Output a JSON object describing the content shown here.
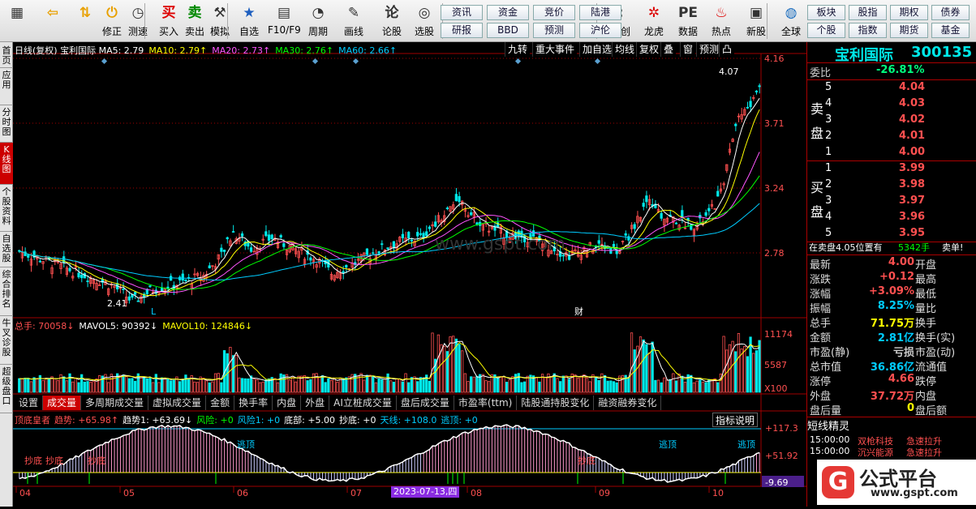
{
  "toolbar": {
    "buttons": [
      {
        "label": "",
        "icon": "windows-icon",
        "name": "windows-button"
      },
      {
        "label": "",
        "icon": "back-arrow-icon",
        "name": "back-button"
      },
      {
        "label": "",
        "icon": "up-down-arrow-icon",
        "name": "scroll-button"
      },
      {
        "label": "修正",
        "icon": "fix-icon",
        "name": "fix-button"
      },
      {
        "label": "测速",
        "icon": "speed-icon",
        "name": "speed-button"
      },
      {
        "label": "买入",
        "icon": "buy-icon",
        "name": "buy-button"
      },
      {
        "label": "卖出",
        "icon": "sell-icon",
        "name": "sell-button"
      },
      {
        "label": "模拟",
        "icon": "simulate-icon",
        "name": "simulate-button"
      },
      {
        "label": "自选",
        "icon": "star-icon",
        "name": "watchlist-button"
      },
      {
        "label": "F10/F9",
        "icon": "f10-icon",
        "name": "f10-button"
      },
      {
        "label": "周期",
        "icon": "period-icon",
        "name": "period-button"
      },
      {
        "label": "画线",
        "icon": "pencil-icon",
        "name": "draw-line-button"
      },
      {
        "label": "论股",
        "icon": "discuss-icon",
        "name": "discuss-button"
      },
      {
        "label": "选股",
        "icon": "select-stock-icon",
        "name": "select-stock-button"
      },
      {
        "label": "科创",
        "icon": "tech-icon",
        "name": "tech-board-button"
      },
      {
        "label": "龙虎",
        "icon": "dragon-icon",
        "name": "dragon-tiger-button"
      },
      {
        "label": "数据",
        "icon": "pe-icon",
        "name": "data-button"
      },
      {
        "label": "热点",
        "icon": "hot-icon",
        "name": "hot-button"
      },
      {
        "label": "新股",
        "icon": "ipo-icon",
        "name": "new-stock-button"
      },
      {
        "label": "全球",
        "icon": "globe-icon",
        "name": "global-button"
      }
    ],
    "small_buttons_1": [
      "资讯",
      "资金",
      "竞价",
      "陆港",
      "研报",
      "BBD",
      "预测",
      "沪伦"
    ],
    "small_buttons_2": [
      "板块",
      "股指",
      "期权",
      "债券",
      "个股",
      "指数",
      "期货",
      "基金"
    ],
    "buy_char": "买",
    "sell_char": "卖"
  },
  "left_tabs": [
    "首页",
    "应用",
    "分时图",
    "K线图",
    "个股资料",
    "自选股",
    "综合排名",
    "牛叉诊股",
    "超级盘口"
  ],
  "chart": {
    "header": "日线(复权) 宝利国际",
    "ma_labels": [
      {
        "text": "MA5: 2.79",
        "color": "#ffffff"
      },
      {
        "text": "MA10: 2.79↑",
        "color": "#ffff00"
      },
      {
        "text": "MA20: 2.73↑",
        "color": "#ff55ff"
      },
      {
        "text": "MA30: 2.76↑",
        "color": "#00ff00"
      },
      {
        "text": "MA60: 2.66↑",
        "color": "#00ccff"
      }
    ],
    "chart_toolbar": [
      "九转",
      "重大事件",
      "加自选",
      "均线",
      "复权",
      "叠",
      "窗",
      "预测",
      "凸"
    ],
    "price_ticks": [
      "4.16",
      "3.71",
      "3.24",
      "2.78"
    ],
    "high_label": "4.07",
    "low_label": "2.41",
    "marker_L": "L",
    "marker_cai": "财",
    "volume_legend": [
      {
        "text": "总手: 70058↓",
        "color": "#ff5050"
      },
      {
        "text": "MAVOL5: 90392↓",
        "color": "#ffffff"
      },
      {
        "text": "MAVOL10: 124846↓",
        "color": "#ffff00"
      }
    ],
    "vol_ticks": [
      "11174",
      "5587",
      "X100"
    ],
    "indicator_tabs": [
      "设置",
      "成交量",
      "多周期成交量",
      "虚拟成交量",
      "金额",
      "换手率",
      "内盘",
      "外盘",
      "AI立桩成交量",
      "盘后成交量",
      "市盈率(ttm)",
      "陆股通持股变化",
      "融资融券变化"
    ],
    "indicator_tab_active": "成交量",
    "ind_legend": [
      {
        "text": "顶底皇者",
        "color": "#ff5050"
      },
      {
        "text": "趋势: +65.98↑",
        "color": "#ff5050"
      },
      {
        "text": "趋势1: +63.69↓",
        "color": "#ffffff"
      },
      {
        "text": "风险: +0",
        "color": "#00ff00"
      },
      {
        "text": "风险1: +0",
        "color": "#00ccff"
      },
      {
        "text": "底部: +5.00",
        "color": "#ffffff"
      },
      {
        "text": "抄底: +0",
        "color": "#ffffff"
      },
      {
        "text": "天线: +108.0",
        "color": "#00ccff"
      },
      {
        "text": "逃顶: +0",
        "color": "#00ccff"
      }
    ],
    "indicator_help": "指标说明",
    "ind_ticks": [
      "+117.3",
      "+51.92",
      "-9.69"
    ],
    "ind_text_labels": [
      "抄底",
      "抄底",
      "抄底",
      "逃顶",
      "抄底",
      "逃顶",
      "逃顶"
    ],
    "x_dates": [
      "04",
      "05",
      "06",
      "07",
      "08",
      "09",
      "10"
    ],
    "cursor_date": "2023-07-13,四",
    "watermark": "www.gspt.com",
    "colors": {
      "up": "#ff5050",
      "down": "#00e8e8",
      "grid": "#a00000",
      "bg": "#000000"
    }
  },
  "right_panel": {
    "name": "宝利国际",
    "code": "300135",
    "weibi_label": "委比",
    "weibi_value": "-26.81%",
    "sell_label": "卖盘",
    "buy_label": "买盘",
    "sells": [
      {
        "lvl": "5",
        "price": "4.04"
      },
      {
        "lvl": "4",
        "price": "4.03"
      },
      {
        "lvl": "3",
        "price": "4.02"
      },
      {
        "lvl": "2",
        "price": "4.01"
      },
      {
        "lvl": "1",
        "price": "4.00"
      }
    ],
    "buys": [
      {
        "lvl": "1",
        "price": "3.99"
      },
      {
        "lvl": "2",
        "price": "3.98"
      },
      {
        "lvl": "3",
        "price": "3.97"
      },
      {
        "lvl": "4",
        "price": "3.96"
      },
      {
        "lvl": "5",
        "price": "3.95"
      }
    ],
    "trade_line": "在卖盘4.05位置有",
    "trade_qty": "5342手",
    "trade_side": "卖单!",
    "quote": [
      {
        "l": "最新",
        "v": "4.00",
        "c": "#ff5050",
        "r": "开盘"
      },
      {
        "l": "涨跌",
        "v": "+0.12",
        "c": "#ff5050",
        "r": "最高"
      },
      {
        "l": "涨幅",
        "v": "+3.09%",
        "c": "#ff5050",
        "r": "最低"
      },
      {
        "l": "振幅",
        "v": "8.25%",
        "c": "#00ccff",
        "r": "量比"
      },
      {
        "l": "总手",
        "v": "71.75万",
        "c": "#ffff00",
        "r": "换手"
      },
      {
        "l": "金额",
        "v": "2.81亿",
        "c": "#00ccff",
        "r": "换手(实)"
      },
      {
        "l": "市盈(静)",
        "v": "亏损",
        "c": "#cccccc",
        "r": "市盈(动)"
      },
      {
        "l": "总市值",
        "v": "36.86亿",
        "c": "#00ccff",
        "r": "流通值"
      },
      {
        "l": "涨停",
        "v": "4.66",
        "c": "#ff5050",
        "r": "跌停"
      },
      {
        "l": "外盘",
        "v": "37.72万",
        "c": "#ff5050",
        "r": "内盘"
      },
      {
        "l": "盘后量",
        "v": "0",
        "c": "#ffff00",
        "r": "盘后额"
      }
    ],
    "short_title": "短线精灵",
    "short_items": [
      {
        "time": "15:00:00",
        "name": "双枪科技",
        "event": "急速拉升"
      },
      {
        "time": "15:00:00",
        "name": "沉兴能源",
        "event": "急速拉升"
      }
    ]
  },
  "badge": {
    "text": "公式平台",
    "url": "www.gspt.com"
  }
}
